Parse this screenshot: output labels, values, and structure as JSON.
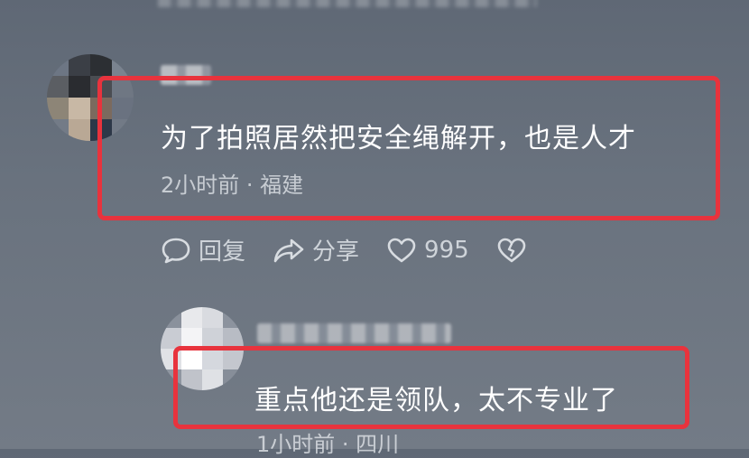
{
  "comment1": {
    "text": "为了拍照居然把安全绳解开，也是人才",
    "meta": "2小时前 · 福建",
    "actions": {
      "reply_label": "回复",
      "share_label": "分享",
      "like_count": "995"
    }
  },
  "comment2": {
    "text": "重点他还是领队，太不专业了",
    "meta": "1小时前 · 四川"
  },
  "colors": {
    "highlight_border": "#e8333d",
    "background": "#6a7380"
  },
  "icons": {
    "reply": "speech-bubble-icon",
    "share": "share-arrow-icon",
    "like": "heart-icon",
    "dislike": "broken-heart-icon"
  }
}
